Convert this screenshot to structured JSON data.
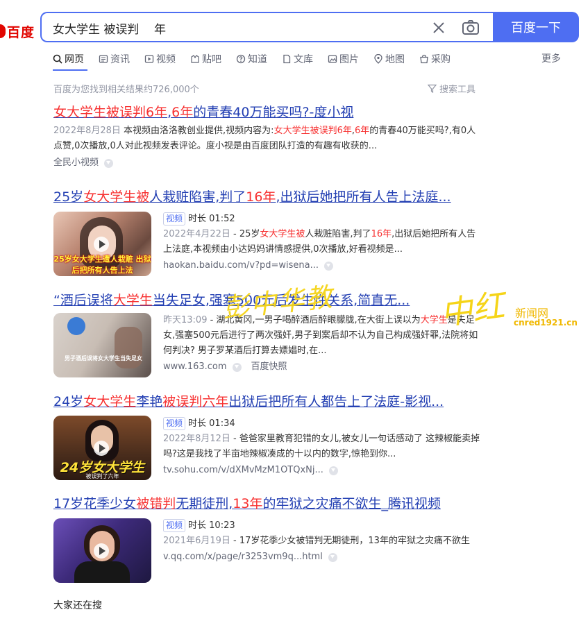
{
  "logo": {
    "text": "百度"
  },
  "search": {
    "query": "女大学生 被误判    年",
    "button": "百度一下"
  },
  "tabs": [
    {
      "label": "网页",
      "icon": "search-icon"
    },
    {
      "label": "资讯",
      "icon": "news-icon"
    },
    {
      "label": "视频",
      "icon": "video-icon"
    },
    {
      "label": "贴吧",
      "icon": "tieba-icon"
    },
    {
      "label": "知道",
      "icon": "question-icon"
    },
    {
      "label": "文库",
      "icon": "document-icon"
    },
    {
      "label": "图片",
      "icon": "image-icon"
    },
    {
      "label": "地图",
      "icon": "map-pin-icon"
    },
    {
      "label": "采购",
      "icon": "shopping-icon"
    }
  ],
  "tab_more": "更多",
  "stats": {
    "count_text": "百度为您找到相关结果约726,000个",
    "tools": "搜索工具"
  },
  "results": [
    {
      "title_parts": [
        "女大学生",
        "被误判",
        "6年",
        ",",
        "6年",
        "的青春40万能买吗?-度小视"
      ],
      "date": "2022年8月28日",
      "desc_a": " 本视频由洛洛教创业提供,视频内容为:",
      "desc_hl1": "女大学生被误判6年",
      "desc_b": ",",
      "desc_hl2": "6年",
      "desc_c": "的青春40万能买吗?,有0人点赞,0次播放,0人对此视频发表评论。度小视是由百度团队打造的有趣有收获的...",
      "source": "全民小视频"
    },
    {
      "title_parts": [
        "25岁",
        "女大学生被",
        "人栽赃陷害,判了",
        "16年",
        ",出狱后她把所有人告上法庭..."
      ],
      "tag": "视频",
      "duration": "时长 01:52",
      "date": "2022年4月22日",
      "desc_a": " - 25岁",
      "desc_hl1": "女大学生被",
      "desc_b": "人栽赃陷害,判了",
      "desc_hl2": "16年",
      "desc_c": ",出狱后她把所有人告上法庭,本视频由小达妈妈讲情感提供,0次播放,好看视频是...",
      "source": "haokan.baidu.com/v?pd=wisena...",
      "thumb_caption": "25岁女大学生遭人栽赃 出狱后把所有人告上法"
    },
    {
      "title_parts": [
        "“酒后误将",
        "大学生",
        "当失足女,强塞500元后发生性关系,简直无..."
      ],
      "date": "昨天13:09",
      "desc_a": " - 湖北黄冈,一男子喝醉酒后醉眼朦胧,在大街上误以为",
      "desc_hl1": "大学生",
      "desc_b": "是失足女,强塞500元后进行了两次强奸,男子到案后却不认为自己构成强奸罪,法院将如何判决? 男子罗某酒后打算去嫖娼时,在...",
      "desc_hl2": "",
      "desc_c": "",
      "source": "www.163.com",
      "source2": "百度快照",
      "thumb_caption": "男子酒后误将女大学生当失足女"
    },
    {
      "title_parts": [
        "24岁",
        "女大学生",
        "李艳",
        "被误判六年",
        "出狱后把所有人都告上了法庭-影视..."
      ],
      "tag": "视频",
      "duration": "时长 01:34",
      "date": "2022年8月12日",
      "desc_a": " - 爸爸家里教育犯错的女儿,被女儿一句话感动了 这辣椒能卖掉吗?这是我找了半亩地辣椒凑成的十以内的数字,惊艳到你...",
      "desc_hl1": "",
      "desc_b": "",
      "desc_hl2": "",
      "desc_c": "",
      "source": "tv.sohu.com/v/dXMvMzM1OTQxNj...",
      "thumb_caption": "24岁女大学生",
      "thumb_sub": "被误判了六年"
    },
    {
      "title_parts": [
        "17岁花季少女",
        "被错判",
        "无期徒刑,",
        "13年",
        "的牢狱之灾痛不欲生_腾讯视频"
      ],
      "tag": "视频",
      "duration": "时长 10:23",
      "date": "2021年6月19日",
      "desc_a": " - 17岁花季少女被错判无期徒刑，13年的牢狱之灾痛不欲生",
      "desc_hl1": "",
      "desc_b": "",
      "desc_hl2": "",
      "desc_c": "",
      "source": "v.qq.com/x/page/r3253vm9q...html"
    }
  ],
  "also_search": "大家还在搜",
  "watermark": {
    "text": "彭中华教",
    "mark": "中红",
    "name": "新闻网",
    "url": "cnred1921.cn"
  }
}
